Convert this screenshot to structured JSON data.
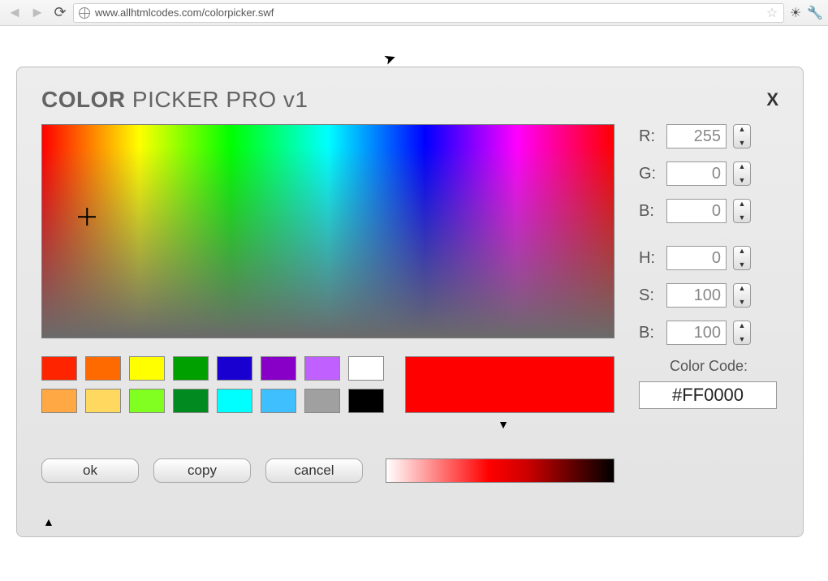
{
  "browser": {
    "url": "www.allhtmlcodes.com/colorpicker.swf"
  },
  "app": {
    "title_bold": "COLOR",
    "title_rest": " PICKER PRO v1",
    "close": "X"
  },
  "rgb": {
    "r_label": "R:",
    "r": "255",
    "g_label": "G:",
    "g": "0",
    "b_label": "B:",
    "b": "0"
  },
  "hsb": {
    "h_label": "H:",
    "h": "0",
    "s_label": "S:",
    "s": "100",
    "b_label": "B:",
    "b": "100"
  },
  "buttons": {
    "ok": "ok",
    "copy": "copy",
    "cancel": "cancel"
  },
  "swatches_row1": [
    "#ff2400",
    "#ff6a00",
    "#ffff00",
    "#00a000",
    "#1a00d0",
    "#8800c8",
    "#c060ff",
    "#ffffff"
  ],
  "swatches_row2": [
    "#ffa844",
    "#ffd860",
    "#80ff20",
    "#008a20",
    "#00ffff",
    "#40bfff",
    "#a0a0a0",
    "#000000"
  ],
  "preview_color": "#ff0000",
  "colorcode": {
    "label": "Color Code:",
    "value": "#FF0000"
  }
}
